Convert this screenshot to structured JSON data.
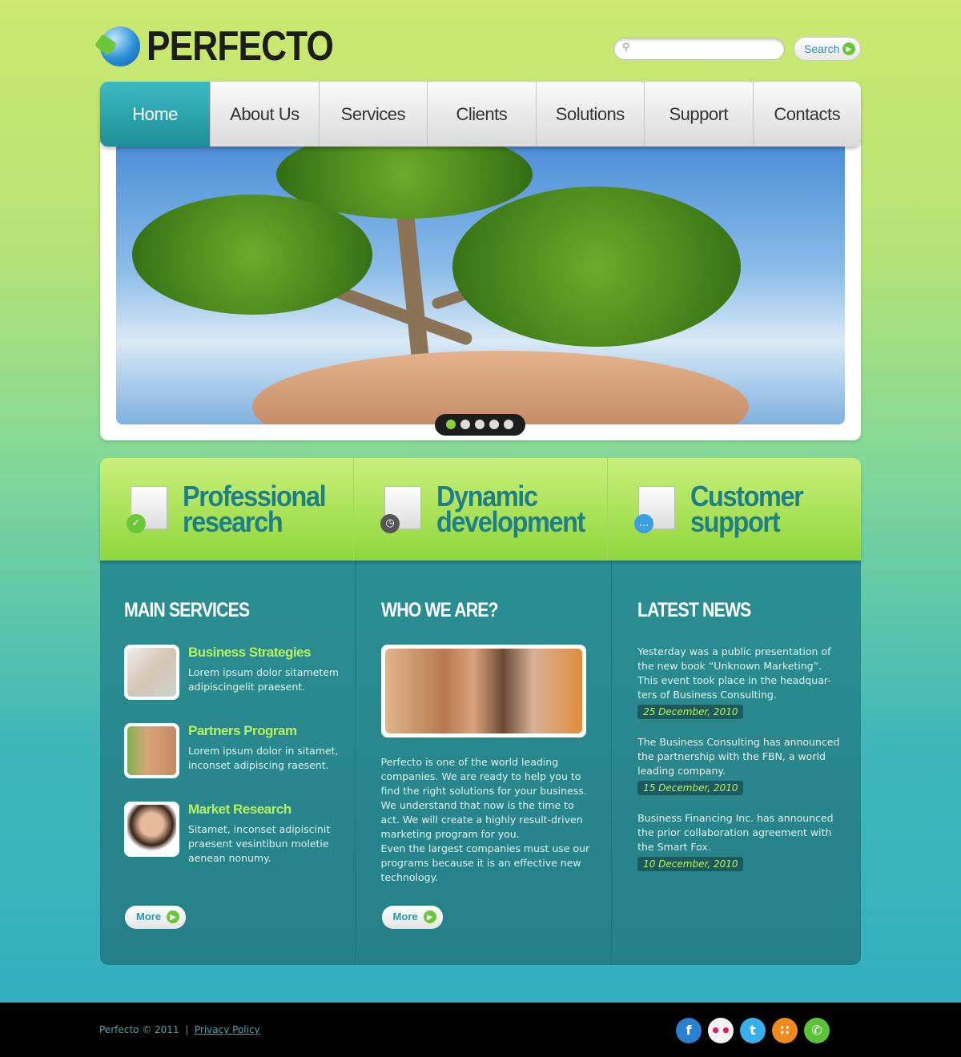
{
  "brand": {
    "name": "PERFECTO"
  },
  "search": {
    "placeholder": "",
    "button": "Search"
  },
  "nav": [
    "Home",
    "About Us",
    "Services",
    "Clients",
    "Solutions",
    "Support",
    "Contacts"
  ],
  "slider": {
    "slides": 5,
    "active": 1
  },
  "features": [
    {
      "title1": "Professional",
      "title2": "research",
      "icon": "check-icon"
    },
    {
      "title1": "Dynamic",
      "title2": "development",
      "icon": "clock-icon"
    },
    {
      "title1": "Customer",
      "title2": "support",
      "icon": "chat-bubble-icon"
    }
  ],
  "services": {
    "heading": "MAIN SERVICES",
    "items": [
      {
        "title": "Business Strategies",
        "text": "Lorem ipsum dolor sitametem adipiscingelit praesent."
      },
      {
        "title": "Partners Program",
        "text": "Lorem ipsum dolor in sitamet, inconset adipiscing raesent."
      },
      {
        "title": "Market Research",
        "text": "Sitamet, inconset adipiscinit praesent vesintibun moletie aenean nonumy."
      }
    ],
    "more": "More"
  },
  "who": {
    "heading": "WHO WE ARE?",
    "text1": "Perfecto is one of the world leading companies. We are ready to help you to find the right solutions for your business. We understand that now is the time to act. We will create a highly result-driven marketing program for you.",
    "text2": "Even the largest companies must use our programs because it is an effective new technology.",
    "more": "More"
  },
  "news": {
    "heading": "LATEST NEWS",
    "items": [
      {
        "text": "Yesterday was a public presentation of the new book “Unknown Marketing”. This event took place in the headquar-ters of Business Consulting.",
        "date": "25 December, 2010"
      },
      {
        "text": "The Business Consulting has announced the partnership with the FBN, a world leading company.",
        "date": "15 December, 2010"
      },
      {
        "text": "Business Financing Inc. has announced the prior collaboration agreement with the Smart Fox.",
        "date": "10 December, 2010"
      }
    ]
  },
  "footer": {
    "copyright": "Perfecto © 2011",
    "separator": "|",
    "privacy": "Privacy Policy",
    "social": [
      "facebook",
      "flickr",
      "twitter",
      "rss",
      "chat"
    ]
  }
}
